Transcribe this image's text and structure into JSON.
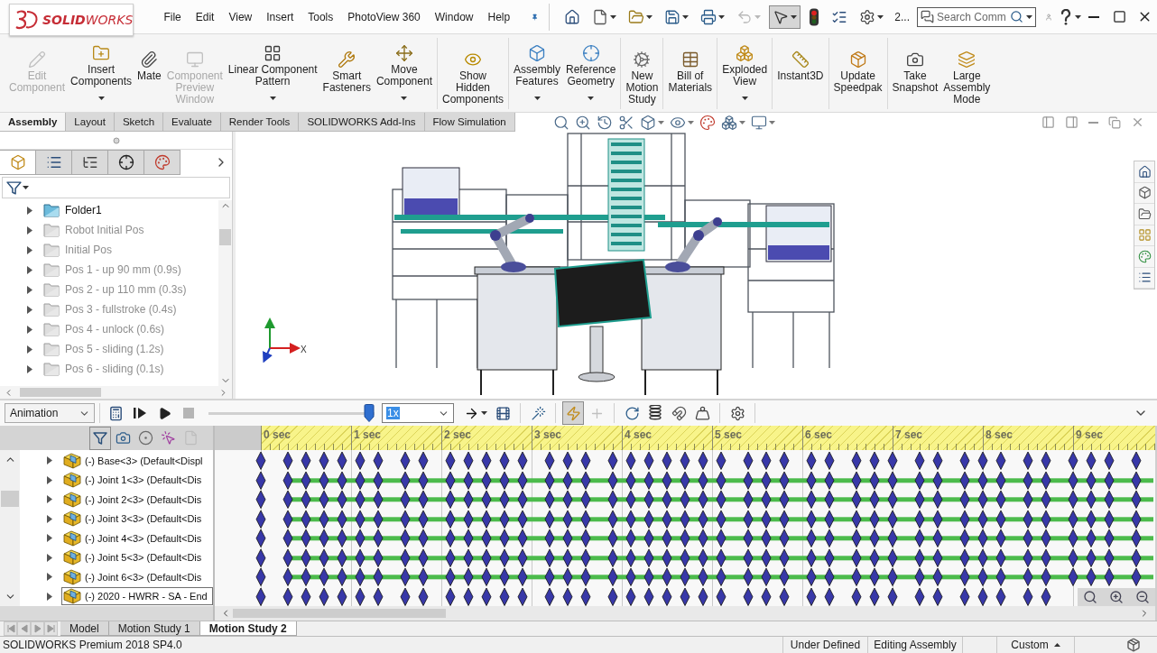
{
  "app_bar": {
    "logo": "**SOLID**WORKS",
    "menu": [
      "File",
      "Edit",
      "View",
      "Insert",
      "Tools",
      "PhotoView 360",
      "Window",
      "Help"
    ],
    "quick_access": [
      {
        "pressed": false,
        "disabled": false
      },
      {
        "pressed": false,
        "disabled": false
      },
      {
        "pressed": false,
        "disabled": false
      },
      {
        "pressed": false,
        "disabled": false
      },
      {
        "pressed": false,
        "disabled": false
      },
      {
        "pressed": false,
        "disabled": true
      },
      {
        "pressed": true,
        "disabled": false
      },
      {
        "pressed": false,
        "disabled": false
      },
      {
        "pressed": false,
        "disabled": false
      },
      {
        "pressed": false,
        "disabled": false
      }
    ],
    "overflow": "2...",
    "search": {
      "placeholder": "Search Comm"
    }
  },
  "ribbon": {
    "groups": [
      [
        {
          "label": "Edit\nComponent",
          "disabled": true,
          "dropdown": false
        },
        {
          "label": "Insert\nComponents",
          "disabled": false,
          "dropdown": true
        },
        {
          "label": "Mate",
          "disabled": false,
          "dropdown": false
        },
        {
          "label": "Component\nPreview\nWindow",
          "disabled": true,
          "dropdown": false
        },
        {
          "label": "Linear Component\nPattern",
          "disabled": false,
          "dropdown": true
        },
        {
          "label": "Smart\nFasteners",
          "disabled": false,
          "dropdown": false
        },
        {
          "label": "Move\nComponent",
          "disabled": false,
          "dropdown": true
        }
      ],
      [
        {
          "label": "Show\nHidden\nComponents",
          "disabled": false,
          "dropdown": false
        }
      ],
      [
        {
          "label": "Assembly\nFeatures",
          "disabled": false,
          "dropdown": true
        },
        {
          "label": "Reference\nGeometry",
          "disabled": false,
          "dropdown": true
        }
      ],
      [
        {
          "label": "New\nMotion\nStudy",
          "disabled": false,
          "dropdown": false
        }
      ],
      [
        {
          "label": "Bill of\nMaterials",
          "disabled": false,
          "dropdown": false
        }
      ],
      [
        {
          "label": "Exploded\nView",
          "disabled": false,
          "dropdown": true
        }
      ],
      [
        {
          "label": "Instant3D",
          "disabled": false,
          "dropdown": false
        }
      ],
      [
        {
          "label": "Update\nSpeedpak",
          "disabled": false,
          "dropdown": false
        }
      ],
      [
        {
          "label": "Take\nSnapshot",
          "disabled": false,
          "dropdown": false
        },
        {
          "label": "Large\nAssembly\nMode",
          "disabled": false,
          "dropdown": false
        }
      ]
    ]
  },
  "command_tabs": [
    {
      "label": "Assembly",
      "selected": true
    },
    {
      "label": "Layout",
      "selected": false
    },
    {
      "label": "Sketch",
      "selected": false
    },
    {
      "label": "Evaluate",
      "selected": false
    },
    {
      "label": "Render Tools",
      "selected": false
    },
    {
      "label": "SOLIDWORKS Add-Ins",
      "selected": false
    },
    {
      "label": "Flow Simulation",
      "selected": false
    }
  ],
  "feature_tree": {
    "panel_tabs": [
      {
        "selected": true
      },
      {
        "selected": false
      },
      {
        "selected": false
      },
      {
        "selected": false
      },
      {
        "selected": false
      }
    ],
    "items": [
      {
        "label": "Folder1",
        "suppressed": false
      },
      {
        "label": "Robot Initial Pos",
        "suppressed": true
      },
      {
        "label": "Initial Pos",
        "suppressed": true
      },
      {
        "label": "Pos 1 - up 90 mm (0.9s)",
        "suppressed": true
      },
      {
        "label": "Pos 2 - up 110 mm (0.3s)",
        "suppressed": true
      },
      {
        "label": "Pos 3 - fullstroke (0.4s)",
        "suppressed": true
      },
      {
        "label": "Pos 4 - unlock (0.6s)",
        "suppressed": true
      },
      {
        "label": "Pos 5 - sliding (1.2s)",
        "suppressed": true
      },
      {
        "label": "Pos 6 - sliding (0.1s)",
        "suppressed": true
      }
    ]
  },
  "graphics": {
    "triad_label": "X"
  },
  "motion_toolbar": {
    "study_type": "Animation",
    "transport": [
      {
        "pressed": false,
        "disabled": false
      },
      {
        "pressed": false,
        "disabled": false
      },
      {
        "pressed": false,
        "disabled": false
      },
      {
        "pressed": false,
        "disabled": true
      }
    ],
    "playback": {
      "level": 1
    },
    "speed": "1x",
    "tools": [
      {
        "pressed": false,
        "disabled": false
      },
      {
        "pressed": false,
        "disabled": false
      },
      {
        "pressed": false,
        "disabled": false
      },
      {
        "pressed": true,
        "disabled": false
      },
      {
        "pressed": false,
        "disabled": true
      },
      {
        "pressed": false,
        "disabled": false
      },
      {
        "pressed": false,
        "disabled": false
      },
      {
        "pressed": false,
        "disabled": false
      },
      {
        "pressed": false,
        "disabled": false
      },
      {
        "pressed": false,
        "disabled": false
      }
    ]
  },
  "timeline": {
    "filters": [
      {
        "pressed": true,
        "disabled": false
      },
      {
        "pressed": false,
        "disabled": false
      },
      {
        "pressed": false,
        "disabled": false
      },
      {
        "pressed": false,
        "disabled": false
      },
      {
        "pressed": false,
        "disabled": true
      }
    ],
    "ticks": [
      "0 sec",
      "1 sec",
      "2 sec",
      "3 sec",
      "4 sec",
      "5 sec",
      "6 sec",
      "7 sec",
      "8 sec",
      "9 sec"
    ],
    "rows": [
      {
        "label": "(-) Base<3> (Default<Displ",
        "selected": false,
        "change_bar": false
      },
      {
        "label": "(-) Joint 1<3> (Default<Dis",
        "selected": false,
        "change_bar": true
      },
      {
        "label": "(-) Joint 2<3> (Default<Dis",
        "selected": false,
        "change_bar": true
      },
      {
        "label": "(-) Joint 3<3> (Default<Dis",
        "selected": false,
        "change_bar": true
      },
      {
        "label": "(-) Joint 4<3> (Default<Dis",
        "selected": false,
        "change_bar": true
      },
      {
        "label": "(-) Joint 5<3> (Default<Dis",
        "selected": false,
        "change_bar": true
      },
      {
        "label": "(-) Joint 6<3> (Default<Dis",
        "selected": false,
        "change_bar": true
      },
      {
        "label": "(-) 2020 - HWRR - SA - End",
        "selected": true,
        "change_bar": false
      }
    ]
  },
  "study_tabs": [
    {
      "label": "Model",
      "selected": false
    },
    {
      "label": "Motion Study 1",
      "selected": false
    },
    {
      "label": "Motion Study 2",
      "selected": true
    }
  ],
  "status_bar": {
    "product": "SOLIDWORKS Premium 2018 SP4.0",
    "definition": "Under Defined",
    "mode": "Editing Assembly",
    "units": "Custom"
  }
}
